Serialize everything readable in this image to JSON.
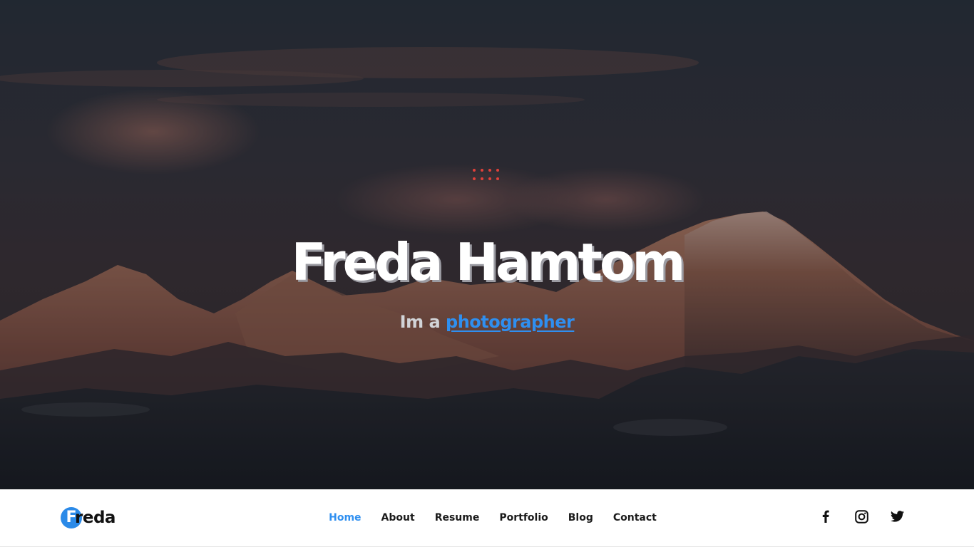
{
  "hero": {
    "title": "Freda Hamtom",
    "subtitle_prefix": "Im a",
    "subtitle_typed": "photographer",
    "accent_color": "#2f8ff0",
    "dots_color": "#e0413a",
    "background_icon": "mountain-landscape-photo"
  },
  "nav": {
    "logo_initial": "F",
    "logo_rest": "reda",
    "logo_color": "#2b8ae8",
    "items": [
      {
        "label": "Home",
        "active": true
      },
      {
        "label": "About",
        "active": false
      },
      {
        "label": "Resume",
        "active": false
      },
      {
        "label": "Portfolio",
        "active": false
      },
      {
        "label": "Blog",
        "active": false
      },
      {
        "label": "Contact",
        "active": false
      }
    ],
    "social": [
      "facebook-icon",
      "instagram-icon",
      "twitter-icon"
    ]
  }
}
